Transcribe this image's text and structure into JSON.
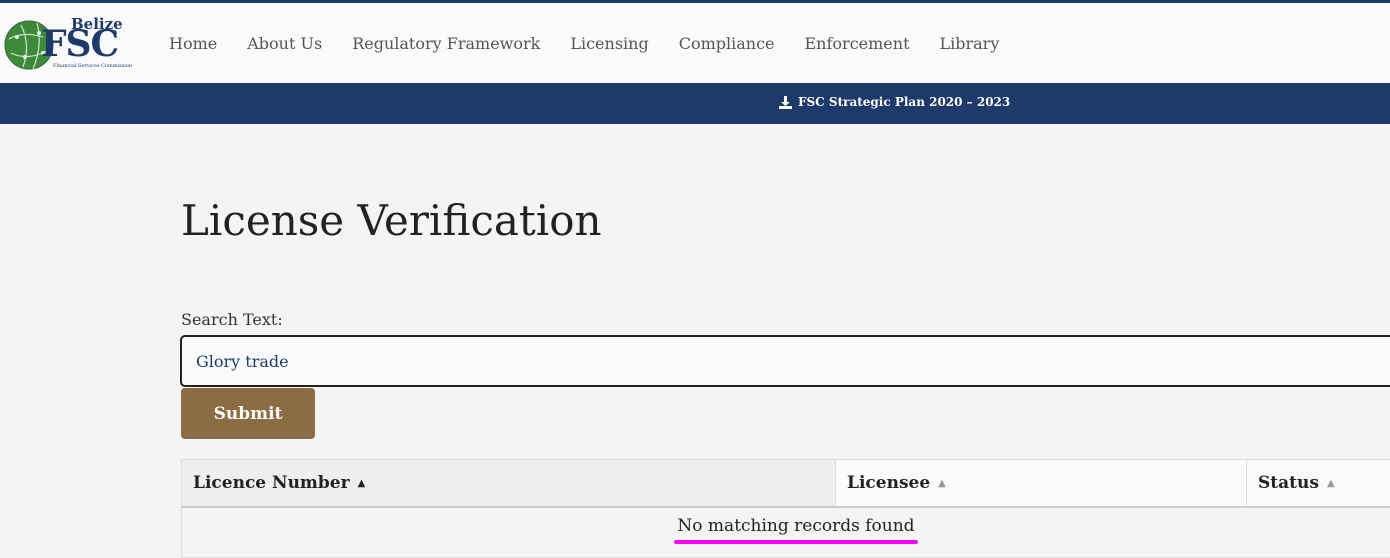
{
  "logo": {
    "top_text": "Belize",
    "main_text": "FSC",
    "sub_text": "Financial Services Commission"
  },
  "nav": {
    "items": [
      {
        "label": "Home"
      },
      {
        "label": "About Us"
      },
      {
        "label": "Regulatory Framework"
      },
      {
        "label": "Licensing"
      },
      {
        "label": "Compliance"
      },
      {
        "label": "Enforcement"
      },
      {
        "label": "Library"
      }
    ]
  },
  "banner": {
    "icon": "download-icon",
    "link_text": "FSC Strategic Plan 2020 – 2023"
  },
  "page": {
    "title": "License Verification"
  },
  "search": {
    "label": "Search Text:",
    "value": "Glory trade",
    "submit_label": "Submit"
  },
  "table": {
    "columns": [
      {
        "label": "Licence Number",
        "sort": "ascending"
      },
      {
        "label": "Licensee",
        "sort": "none"
      },
      {
        "label": "Status",
        "sort": "none"
      }
    ],
    "empty_message": "No matching records found"
  },
  "colors": {
    "brand_navy": "#1e3a6a",
    "submit_button": "#8b6c45",
    "highlight_underline": "#ff00ff"
  }
}
